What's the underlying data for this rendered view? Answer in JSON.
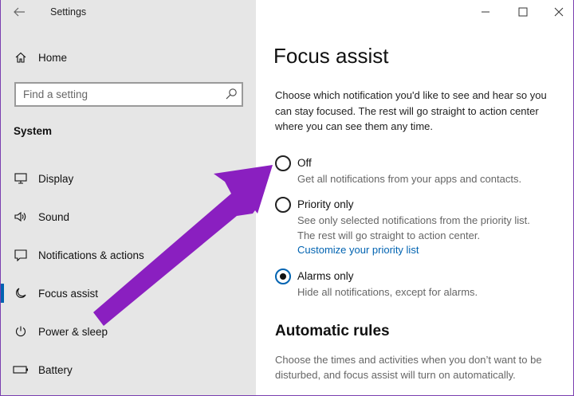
{
  "window": {
    "title": "Settings",
    "back_icon": "back-arrow-icon",
    "controls": {
      "minimize": "minimize-icon",
      "maximize": "maximize-icon",
      "close": "close-icon"
    }
  },
  "sidebar": {
    "home": {
      "label": "Home",
      "icon": "home-icon"
    },
    "search": {
      "placeholder": "Find a setting",
      "value": "",
      "icon": "search-icon"
    },
    "section": "System",
    "items": [
      {
        "label": "Display",
        "icon": "display-icon",
        "selected": false
      },
      {
        "label": "Sound",
        "icon": "sound-icon",
        "selected": false
      },
      {
        "label": "Notifications & actions",
        "icon": "notifications-icon",
        "selected": false
      },
      {
        "label": "Focus assist",
        "icon": "moon-icon",
        "selected": true
      },
      {
        "label": "Power & sleep",
        "icon": "power-icon",
        "selected": false
      },
      {
        "label": "Battery",
        "icon": "battery-icon",
        "selected": false
      }
    ]
  },
  "main": {
    "title": "Focus assist",
    "intro": "Choose which notification you'd like to see and hear so you can stay focused. The rest will go straight to action center where you can see them any time.",
    "options": [
      {
        "label": "Off",
        "desc_lines": [
          "Get all notifications from your apps and contacts."
        ],
        "checked": false
      },
      {
        "label": "Priority only",
        "desc_lines": [
          "See only selected notifications from the priority list.",
          "The rest will go straight to action center."
        ],
        "link": "Customize your priority list",
        "checked": false
      },
      {
        "label": "Alarms only",
        "desc_lines": [
          "Hide all notifications, except for alarms."
        ],
        "checked": true
      }
    ],
    "automatic_rules": {
      "title": "Automatic rules",
      "desc": "Choose the times and activities when you don’t want to be disturbed, and focus assist will turn on automatically."
    }
  },
  "annotation": {
    "arrow_color": "#8a1fc0",
    "target": "Off"
  },
  "colors": {
    "accent": "#0063b1",
    "sidebar_bg": "#e6e6e6"
  }
}
